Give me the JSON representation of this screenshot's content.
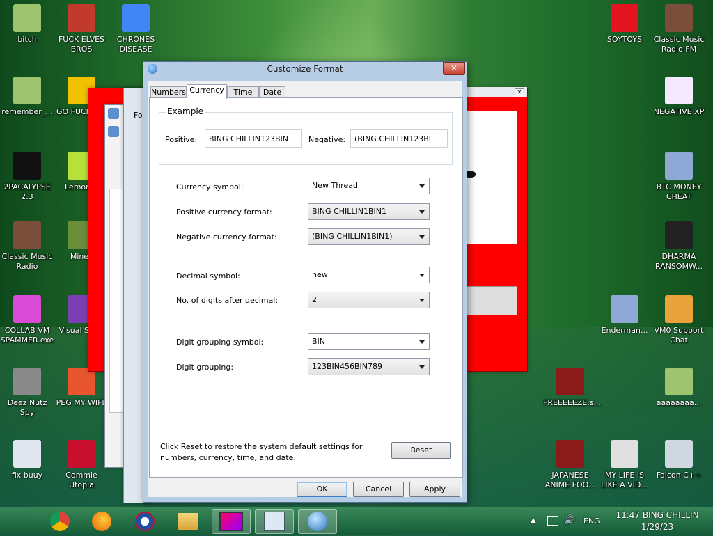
{
  "desktop": {
    "icons": [
      {
        "label": "bitch",
        "icon": "folder-icon",
        "color": "#9fc46f"
      },
      {
        "label": "FUCK ELVES BROS",
        "icon": "santa-icon",
        "color": "#c23a2b"
      },
      {
        "label": "CHRONES DISEASE",
        "icon": "chrome-icon",
        "color": "#4285f4"
      },
      {
        "label": "remember_...",
        "icon": "folder-icon",
        "color": "#9fc46f"
      },
      {
        "label": "GO FUCK DIE",
        "icon": "dj-icon",
        "color": "#f2c200"
      },
      {
        "label": "2PACALYPSE 2.3",
        "icon": "cmd-icon",
        "color": "#111111"
      },
      {
        "label": "LemonW",
        "icon": "lemon-icon",
        "color": "#b7e03a"
      },
      {
        "label": "Classic Music Radio",
        "icon": "portrait-icon",
        "color": "#7a4e3a"
      },
      {
        "label": "Minec",
        "icon": "minecraft-icon",
        "color": "#6b8e3a"
      },
      {
        "label": "COLLAB VM SPAMMER.exe",
        "icon": "monitor-icon",
        "color": "#d94bd4"
      },
      {
        "label": "Visual Stupi",
        "icon": "visual-studio-icon",
        "color": "#7b3fb3"
      },
      {
        "label": "Deez Nutz Spy",
        "icon": "windows-stack-icon",
        "color": "#8a8a8a"
      },
      {
        "label": "PEG MY WIFE",
        "icon": "p-ball-icon",
        "color": "#e8552f"
      },
      {
        "label": "fix buuy",
        "icon": "script-file-icon",
        "color": "#dfe6f0"
      },
      {
        "label": "Commie Utopia",
        "icon": "commie-icon",
        "color": "#c8102e"
      },
      {
        "label": "SOYTOYS",
        "icon": "s-logo-icon",
        "color": "#e3141f"
      },
      {
        "label": "Classic Music Radio FM",
        "icon": "portrait-icon",
        "color": "#7a4e3a"
      },
      {
        "label": "NEGATIVE XP",
        "icon": "bunny-icon",
        "color": "#f3eaff"
      },
      {
        "label": "BTC MONEY CHEAT",
        "icon": "diamond-icon",
        "color": "#8fa9d6"
      },
      {
        "label": "DHARMA RANSOMW...",
        "icon": "skull-icon",
        "color": "#222222"
      },
      {
        "label": "Enderman...",
        "icon": "diamond-icon",
        "color": "#8fa9d6"
      },
      {
        "label": "VM0 Support Chat",
        "icon": "support-person-icon",
        "color": "#e8a33b"
      },
      {
        "label": "FREEEEEZE.s...",
        "icon": "flash-icon",
        "color": "#8b1a1a"
      },
      {
        "label": "aaaaaaaa...",
        "icon": "folder-icon",
        "color": "#9fc46f"
      },
      {
        "label": "JAPANESE ANIME FOO...",
        "icon": "flash-icon",
        "color": "#8b1a1a"
      },
      {
        "label": "MY LIFE IS LIKE A VID...",
        "icon": "gamepad-icon",
        "color": "#e0e0e0"
      },
      {
        "label": "Falcon C++",
        "icon": "recycle-bin-icon",
        "color": "#cfd8e0"
      }
    ]
  },
  "dialog": {
    "title": "Customize Format",
    "close_symbol": "✕",
    "tabs": [
      "Numbers",
      "Currency",
      "Time",
      "Date"
    ],
    "example": {
      "legend": "Example",
      "positive_label": "Positive:",
      "positive_value": "BING CHILLIN123BIN",
      "negative_label": "Negative:",
      "negative_value": "(BING CHILLIN123BI"
    },
    "fields": [
      {
        "label": "Currency symbol:",
        "value": "New Thread",
        "editable": true
      },
      {
        "label": "Positive currency format:",
        "value": "BING CHILLIN1BIN1",
        "editable": false
      },
      {
        "label": "Negative currency format:",
        "value": "(BING CHILLIN1BIN1)",
        "editable": false
      },
      {
        "label": "Decimal symbol:",
        "value": "new",
        "editable": true
      },
      {
        "label": "No. of digits after decimal:",
        "value": "2",
        "editable": false
      },
      {
        "label": "Digit grouping symbol:",
        "value": "BIN",
        "editable": true
      },
      {
        "label": "Digit grouping:",
        "value": "123BIN456BIN789",
        "editable": false
      }
    ],
    "reset_text": "Click Reset to restore the system default settings for numbers, currency, time, and date.",
    "reset_button": "Reset",
    "ok_button": "OK",
    "cancel_button": "Cancel",
    "apply_button": "Apply"
  },
  "background_windows": {
    "fragment_label": "Fo"
  },
  "taskbar": {
    "clock_time": "11:47 BING CHILLIN",
    "clock_date": "1/29/23",
    "language": "ENG"
  }
}
